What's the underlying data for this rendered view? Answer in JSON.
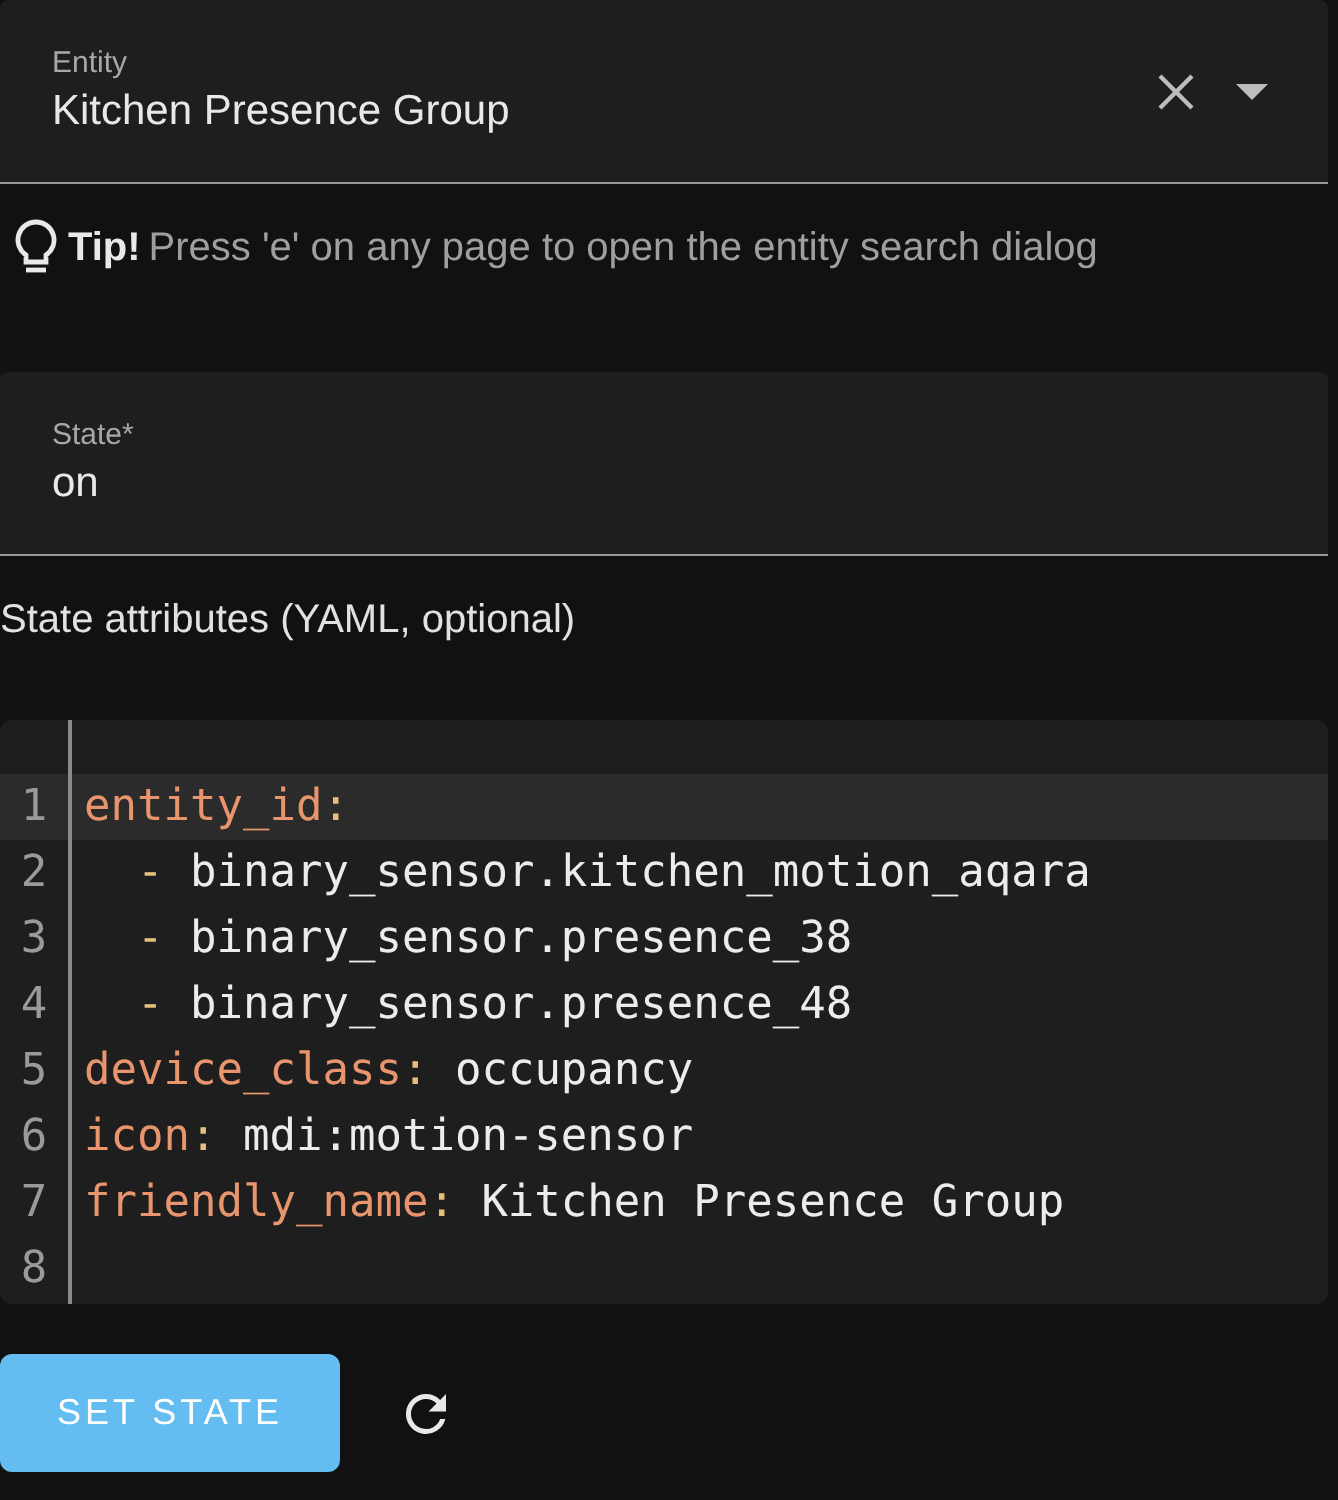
{
  "entity_field": {
    "label": "Entity",
    "value": "Kitchen Presence Group"
  },
  "tip": {
    "title": "Tip!",
    "text": "Press 'e' on any page to open the entity search dialog"
  },
  "state_field": {
    "label": "State*",
    "value": "on"
  },
  "attributes_label": "State attributes (YAML, optional)",
  "editor": {
    "lines": [
      {
        "number": "1",
        "active": true,
        "tokens": [
          {
            "kind": "key",
            "text": "entity_id"
          },
          {
            "kind": "punct",
            "text": ":"
          }
        ]
      },
      {
        "number": "2",
        "active": false,
        "tokens": [
          {
            "kind": "punct",
            "text": "-"
          },
          {
            "kind": "plain",
            "text": "binary_sensor.kitchen_motion_aqara"
          }
        ]
      },
      {
        "number": "3",
        "active": false,
        "tokens": [
          {
            "kind": "punct",
            "text": "-"
          },
          {
            "kind": "plain",
            "text": "binary_sensor.presence_38"
          }
        ]
      },
      {
        "number": "4",
        "active": false,
        "tokens": [
          {
            "kind": "punct",
            "text": "-"
          },
          {
            "kind": "plain",
            "text": "binary_sensor.presence_48"
          }
        ]
      },
      {
        "number": "5",
        "active": false,
        "tokens": [
          {
            "kind": "key",
            "text": "device_class"
          },
          {
            "kind": "punct",
            "text": ":"
          },
          {
            "kind": "plain",
            "text": "occupancy"
          }
        ]
      },
      {
        "number": "6",
        "active": false,
        "tokens": [
          {
            "kind": "key",
            "text": "icon"
          },
          {
            "kind": "punct",
            "text": ":"
          },
          {
            "kind": "plain",
            "text": "mdi:motion-sensor"
          }
        ]
      },
      {
        "number": "7",
        "active": false,
        "tokens": [
          {
            "kind": "key",
            "text": "friendly_name"
          },
          {
            "kind": "punct",
            "text": ":"
          },
          {
            "kind": "plain",
            "text": "Kitchen Presence Group"
          }
        ]
      },
      {
        "number": "8",
        "active": false
      }
    ]
  },
  "set_state_button": "SET STATE"
}
